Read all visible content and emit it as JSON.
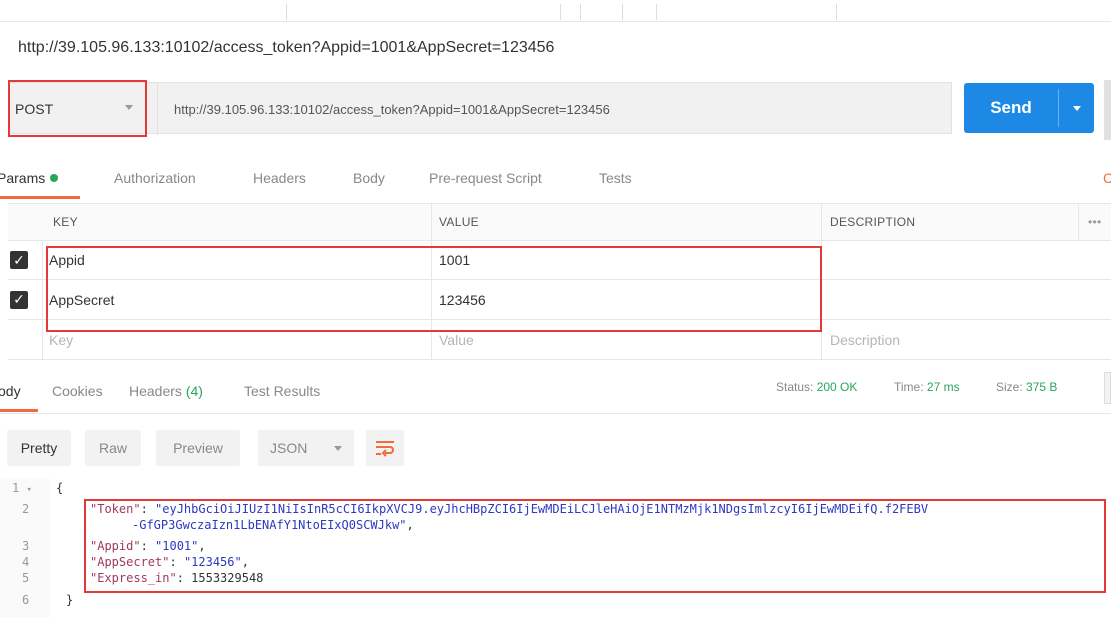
{
  "page_title_url": "http://39.105.96.133:10102/access_token?Appid=1001&AppSecret=123456",
  "request": {
    "method": "POST",
    "url": "http://39.105.96.133:10102/access_token?Appid=1001&AppSecret=123456",
    "send_label": "Send"
  },
  "request_tabs": [
    {
      "label": "Params"
    },
    {
      "label": "Authorization"
    },
    {
      "label": "Headers"
    },
    {
      "label": "Body"
    },
    {
      "label": "Pre-request Script"
    },
    {
      "label": "Tests"
    }
  ],
  "cookies_label": "C",
  "params": {
    "headers": {
      "key": "KEY",
      "value": "VALUE",
      "description": "DESCRIPTION",
      "more": "•••"
    },
    "rows": [
      {
        "key": "Appid",
        "value": "1001",
        "checked": true
      },
      {
        "key": "AppSecret",
        "value": "123456",
        "checked": true
      }
    ],
    "placeholders": {
      "key": "Key",
      "value": "Value",
      "description": "Description"
    }
  },
  "response_tabs": [
    {
      "label": "ody"
    },
    {
      "label": "Cookies"
    },
    {
      "label": "Headers",
      "count": "(4)"
    },
    {
      "label": "Test Results"
    }
  ],
  "status": {
    "status_label": "Status:",
    "status_value": "200 OK",
    "time_label": "Time:",
    "time_value": "27 ms",
    "size_label": "Size:",
    "size_value": "375 B"
  },
  "view": {
    "pretty": "Pretty",
    "raw": "Raw",
    "preview": "Preview",
    "format": "JSON"
  },
  "code": {
    "line_numbers": [
      "1",
      "2",
      "3",
      "4",
      "5",
      "6"
    ],
    "open_brace": "{",
    "close_brace": "}",
    "token_key": "\"Token\"",
    "token_value_part1": "\"eyJhbGciOiJIUzI1NiIsInR5cCI6IkpXVCJ9.eyJhcHBpZCI6IjEwMDEiLCJleHAiOjE1NTMzMjk1NDgsImlzcyI6IjEwMDEifQ.f2FEBV",
    "token_value_part2": "-GfGP3GwczaIzn1LbENAfY1NtoEIxQ0SCWJkw\"",
    "appid_key": "\"Appid\"",
    "appid_value": "\"1001\"",
    "appsecret_key": "\"AppSecret\"",
    "appsecret_value": "\"123456\"",
    "expires_key": "\"Express_in\"",
    "expires_value": "1553329548"
  },
  "colors": {
    "send_button": "#1e88e5",
    "highlight_box": "#e53935",
    "active_tab_underline": "#f26b3a",
    "status_ok": "#26a65b"
  }
}
